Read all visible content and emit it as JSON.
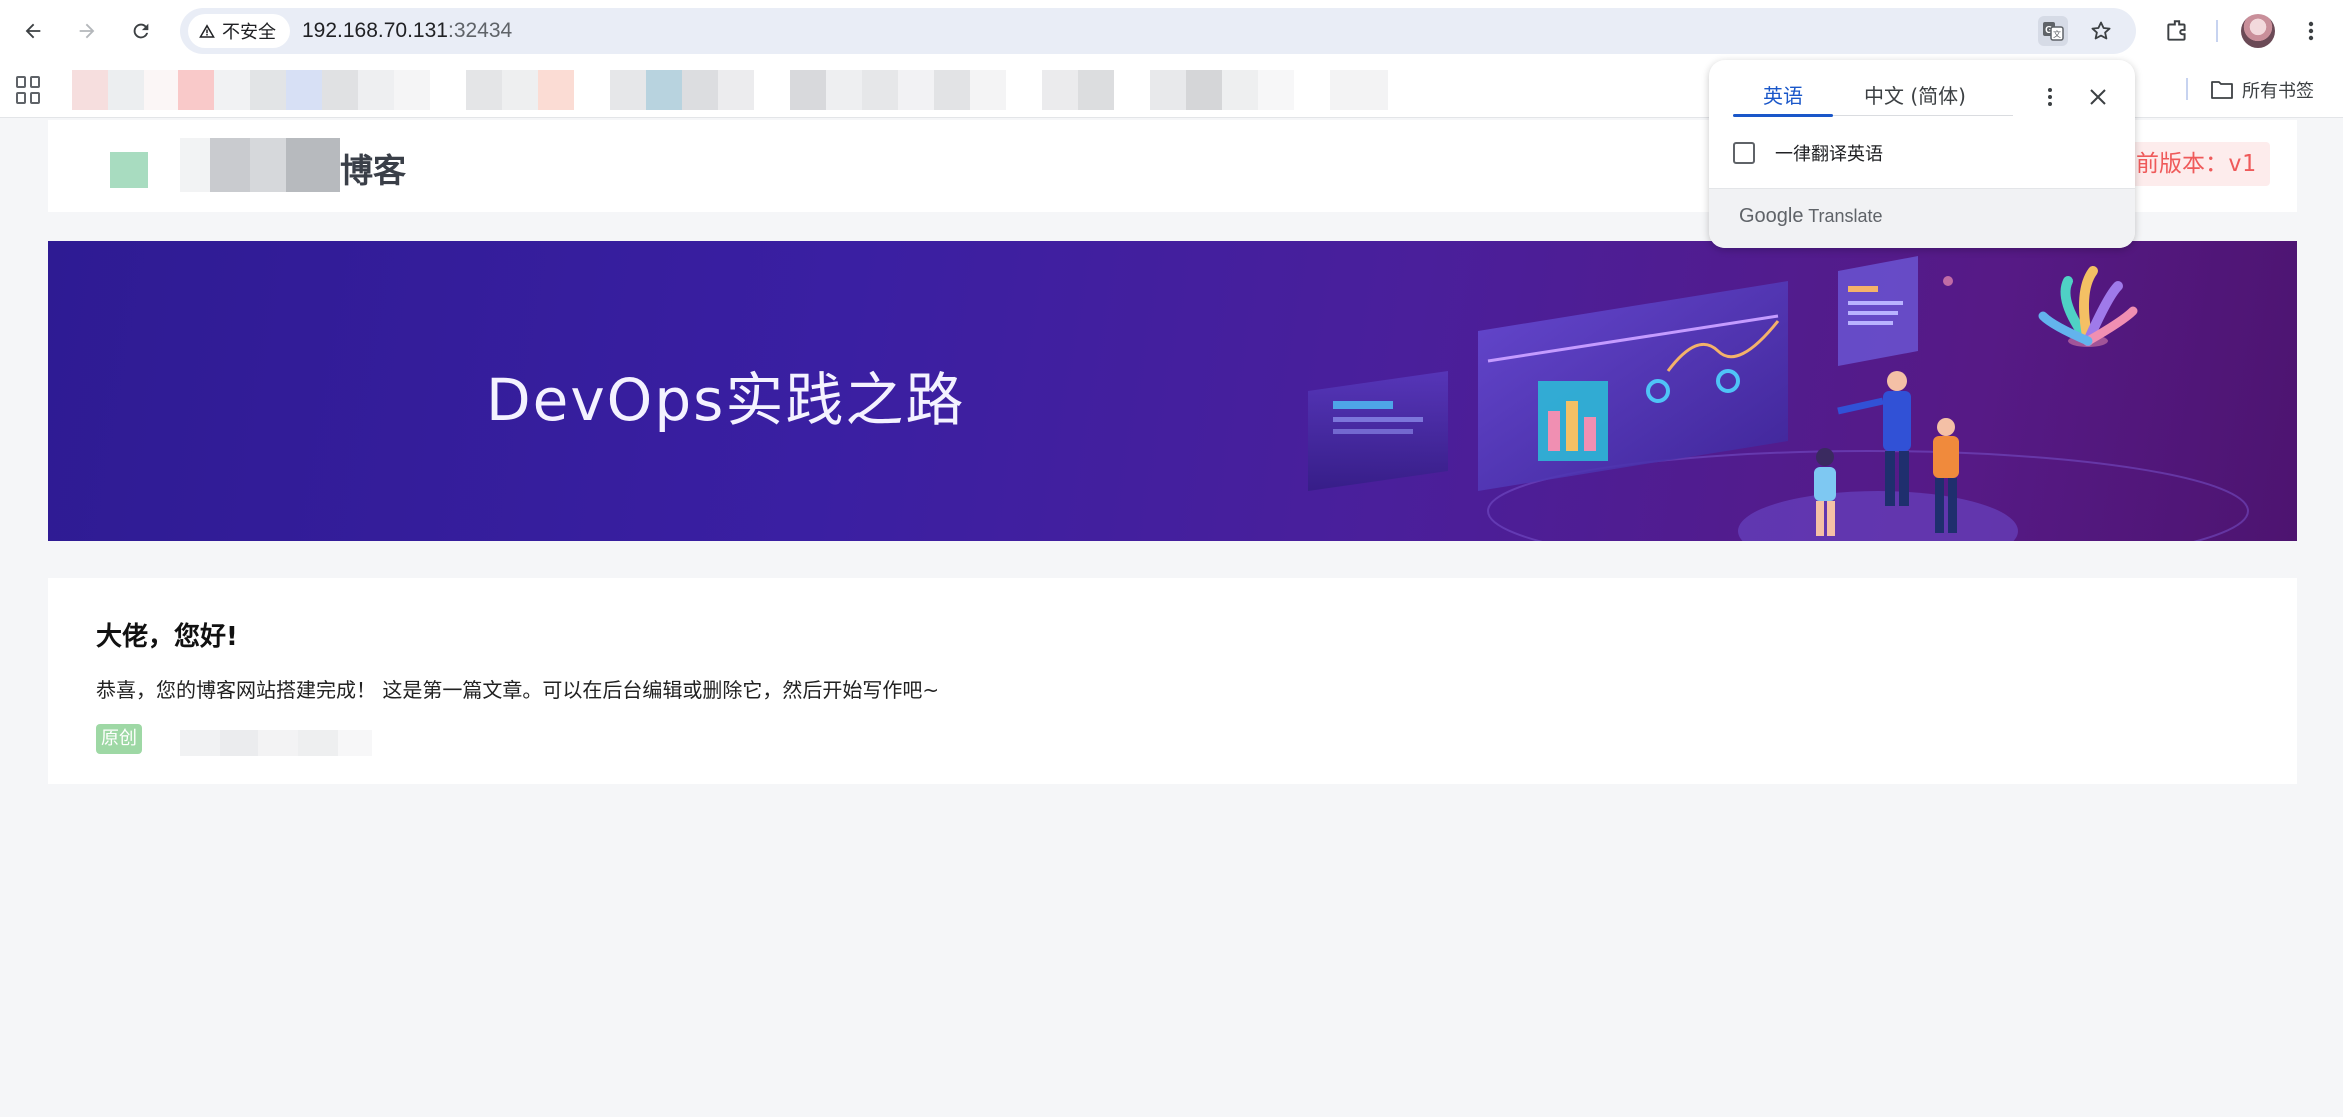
{
  "browser": {
    "security_label": "不安全",
    "url_host": "192.168.70.131",
    "url_port": ":32434",
    "all_bookmarks_label": "所有书签"
  },
  "site": {
    "title_suffix": "博客",
    "version_badge": "前版本：v1",
    "banner_title": "DevOps实践之路"
  },
  "post": {
    "title": "大佬，您好!",
    "excerpt": "恭喜，您的博客网站搭建完成！ 这是第一篇文章。可以在后台编辑或删除它，然后开始写作吧~",
    "tag": "原创"
  },
  "translate_popup": {
    "tab_source": "英语",
    "tab_target": "中文 (简体)",
    "always_translate_label": "一律翻译英语",
    "brand_google": "Google",
    "brand_translate": "Translate"
  },
  "colors": {
    "accent_blue": "#1a57c9",
    "badge_red": "#ef5a5a",
    "tag_green": "#9ed8a5",
    "banner_purple": "#3a1fa2"
  }
}
